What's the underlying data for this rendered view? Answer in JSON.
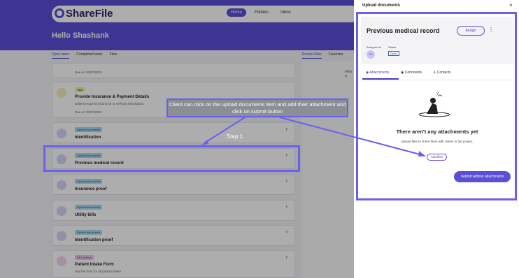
{
  "app": {
    "brand": "ShareFile",
    "nav": [
      "Home",
      "Folders",
      "Inbox"
    ],
    "greeting": "Hello Shashank",
    "tabs": [
      "Open tasks",
      "Completed tasks",
      "Files"
    ],
    "right_tabs": [
      "Recent Files",
      "Favorites"
    ],
    "right_files_label": "Files a"
  },
  "tasks": [
    {
      "badge": "",
      "title": "",
      "sub": "Due on 03/07/2025"
    },
    {
      "badge": "Task",
      "title": "Provide Insurance & Payment Details",
      "sub": "Submit required insurance or self-pay information.",
      "due": "Due on 03/07/2025"
    },
    {
      "badge": "Upload documents",
      "title": "Identification"
    },
    {
      "badge": "Upload documents",
      "title": "Previous medical record"
    },
    {
      "badge": "Upload documents",
      "title": "Insurance proof"
    },
    {
      "badge": "Upload documents",
      "title": "Utility bills"
    },
    {
      "badge": "Upload documents",
      "title": "Identification proof"
    },
    {
      "badge": "Fill out form",
      "title": "Patient Intake Form",
      "sub": "Use the form for all patient intake"
    }
  ],
  "annotation": {
    "callout": "Client can click on the upload documents item and add their attachment  and click on submit button",
    "step": "Step 1"
  },
  "panel": {
    "title": "Upload documents",
    "close": "×",
    "doc_title": "Previous medical record",
    "assign": "Assign",
    "kebab": "⋮",
    "assigned_to_label": "Assigned to",
    "status_label": "Status",
    "avatar": "SP",
    "status": "Open",
    "tabs": [
      "Attachments",
      "Comments",
      "Contacts"
    ],
    "empty_title": "There aren't any attachments yet",
    "empty_sub": "Upload files to share them with others in the project.",
    "add_files": "Add files",
    "submit": "Submit without attachments"
  },
  "colors": {
    "accent": "#5b4fd6",
    "highlight": "#6b5ff0"
  }
}
